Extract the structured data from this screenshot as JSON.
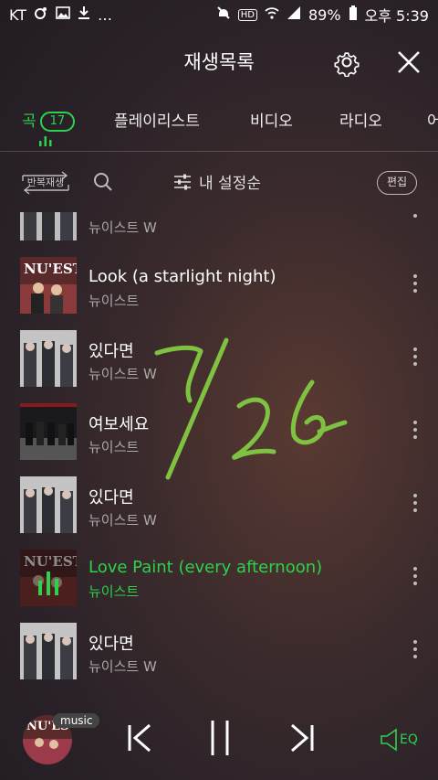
{
  "status_bar": {
    "carrier": "KT",
    "indicators": "…",
    "hd": "HD",
    "battery": "89%",
    "time": "오후 5:39"
  },
  "header": {
    "title": "재생목록"
  },
  "tabs": [
    {
      "label": "곡",
      "count": "17",
      "active": true
    },
    {
      "label": "플레이리스트"
    },
    {
      "label": "비디오"
    },
    {
      "label": "라디오"
    },
    {
      "label": "어"
    }
  ],
  "toolbar": {
    "repeat_label": "반복재생",
    "sort_label": "내 설정순",
    "edit_label": "편집"
  },
  "songs": [
    {
      "title": "",
      "artist": "뉴이스트 W",
      "cover": "w"
    },
    {
      "title": "Look (a starlight night)",
      "artist": "뉴이스트",
      "cover": "nuest"
    },
    {
      "title": "있다면",
      "artist": "뉴이스트 W",
      "cover": "w"
    },
    {
      "title": "여보세요",
      "artist": "뉴이스트",
      "cover": "hello"
    },
    {
      "title": "있다면",
      "artist": "뉴이스트 W",
      "cover": "w"
    },
    {
      "title": "Love Paint (every afternoon)",
      "artist": "뉴이스트",
      "cover": "nuest",
      "playing": true
    },
    {
      "title": "있다면",
      "artist": "뉴이스트 W",
      "cover": "w"
    }
  ],
  "player": {
    "badge": "music",
    "eq_label": "EQ"
  },
  "colors": {
    "accent": "#2ed14b",
    "background": "#2a2228"
  }
}
